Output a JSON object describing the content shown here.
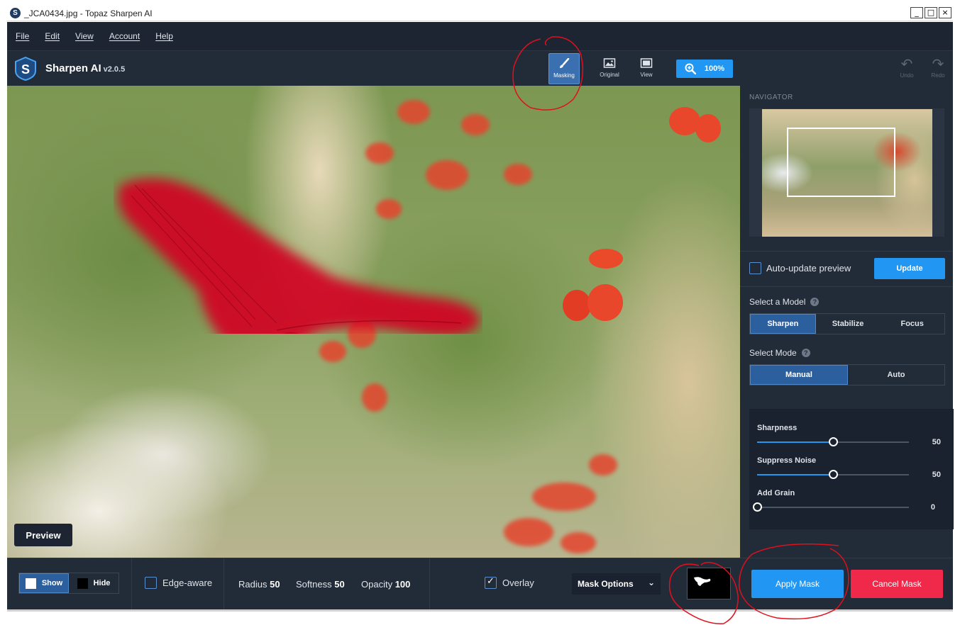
{
  "window": {
    "title": "_JCA0434.jpg - Topaz Sharpen AI",
    "controls": {
      "minimize": "_",
      "maximize": "□",
      "close": "×"
    }
  },
  "menu": [
    "File",
    "Edit",
    "View",
    "Account",
    "Help"
  ],
  "toolbar": {
    "brand": "Sharpen AI",
    "version": "v2.0.5",
    "masking_label": "Masking",
    "original_label": "Original",
    "view_label": "View",
    "zoom_label": "100%",
    "undo_label": "Undo",
    "redo_label": "Redo"
  },
  "canvas": {
    "preview_label": "Preview"
  },
  "navigator": {
    "title": "NAVIGATOR"
  },
  "panel": {
    "auto_update_label": "Auto-update preview",
    "auto_update_checked": false,
    "update_label": "Update",
    "select_model_label": "Select a Model",
    "models": [
      "Sharpen",
      "Stabilize",
      "Focus"
    ],
    "selected_model": "Sharpen",
    "select_mode_label": "Select Mode",
    "modes": [
      "Manual",
      "Auto"
    ],
    "selected_mode": "Manual",
    "sliders": [
      {
        "label": "Sharpness",
        "value": "50",
        "fraction": 0.5
      },
      {
        "label": "Suppress Noise",
        "value": "50",
        "fraction": 0.5
      },
      {
        "label": "Add Grain",
        "value": "0",
        "fraction": 0.0
      }
    ],
    "apply_mask_label": "Apply Mask",
    "cancel_mask_label": "Cancel Mask"
  },
  "bottombar": {
    "show_label": "Show",
    "hide_label": "Hide",
    "edge_aware_label": "Edge-aware",
    "edge_aware_checked": false,
    "radius_label": "Radius",
    "radius_value": "50",
    "softness_label": "Softness",
    "softness_value": "50",
    "opacity_label": "Opacity",
    "opacity_value": "100",
    "overlay_label": "Overlay",
    "overlay_checked": true,
    "mask_options_label": "Mask Options"
  },
  "colors": {
    "accent": "#2196f3",
    "cancel": "#f0284a",
    "mask_overlay": "#d40022",
    "annotation": "#e0101c"
  }
}
